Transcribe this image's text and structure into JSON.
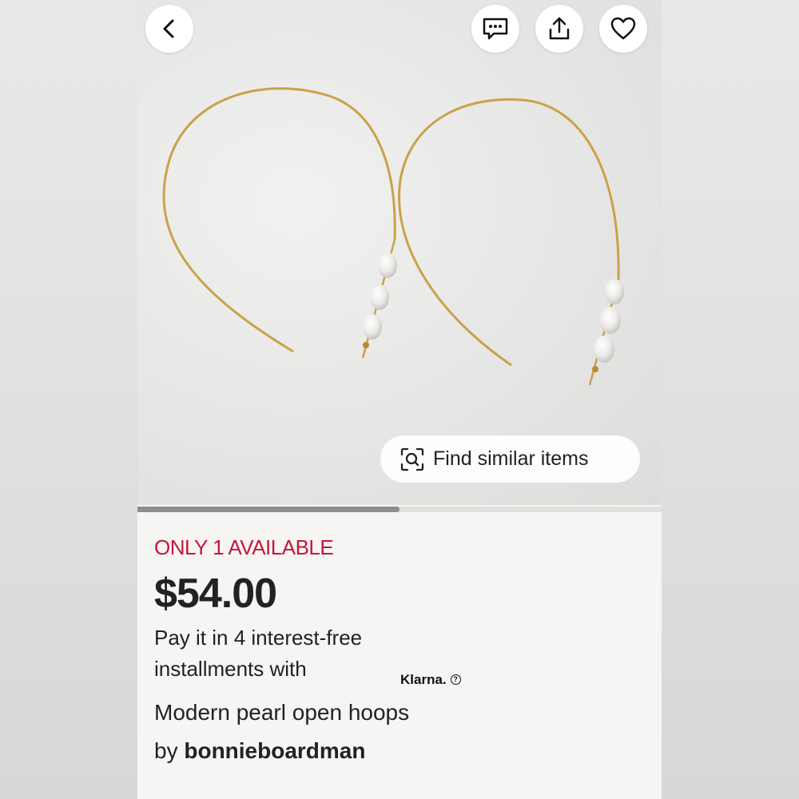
{
  "product": {
    "availability": "ONLY 1 AVAILABLE",
    "price": "$54.00",
    "payment_line1": "Pay it in 4 interest-free",
    "payment_line2": "installments with",
    "payment_provider": "Klarna.",
    "title": "Modern pearl open hoops",
    "seller_prefix": "by",
    "seller_name": "bonnieboardman"
  },
  "image_actions": {
    "find_similar_label": "Find similar items"
  },
  "gallery": {
    "progress_fraction": 0.5
  },
  "icons": {
    "back": "chevron-left-icon",
    "message": "message-dots-icon",
    "share": "share-upload-icon",
    "favorite": "heart-icon",
    "visual_search": "visual-search-icon",
    "info": "question-circle-icon"
  },
  "colors": {
    "availability": "#c4183c",
    "text": "#222222",
    "background": "#f6f5f3"
  }
}
